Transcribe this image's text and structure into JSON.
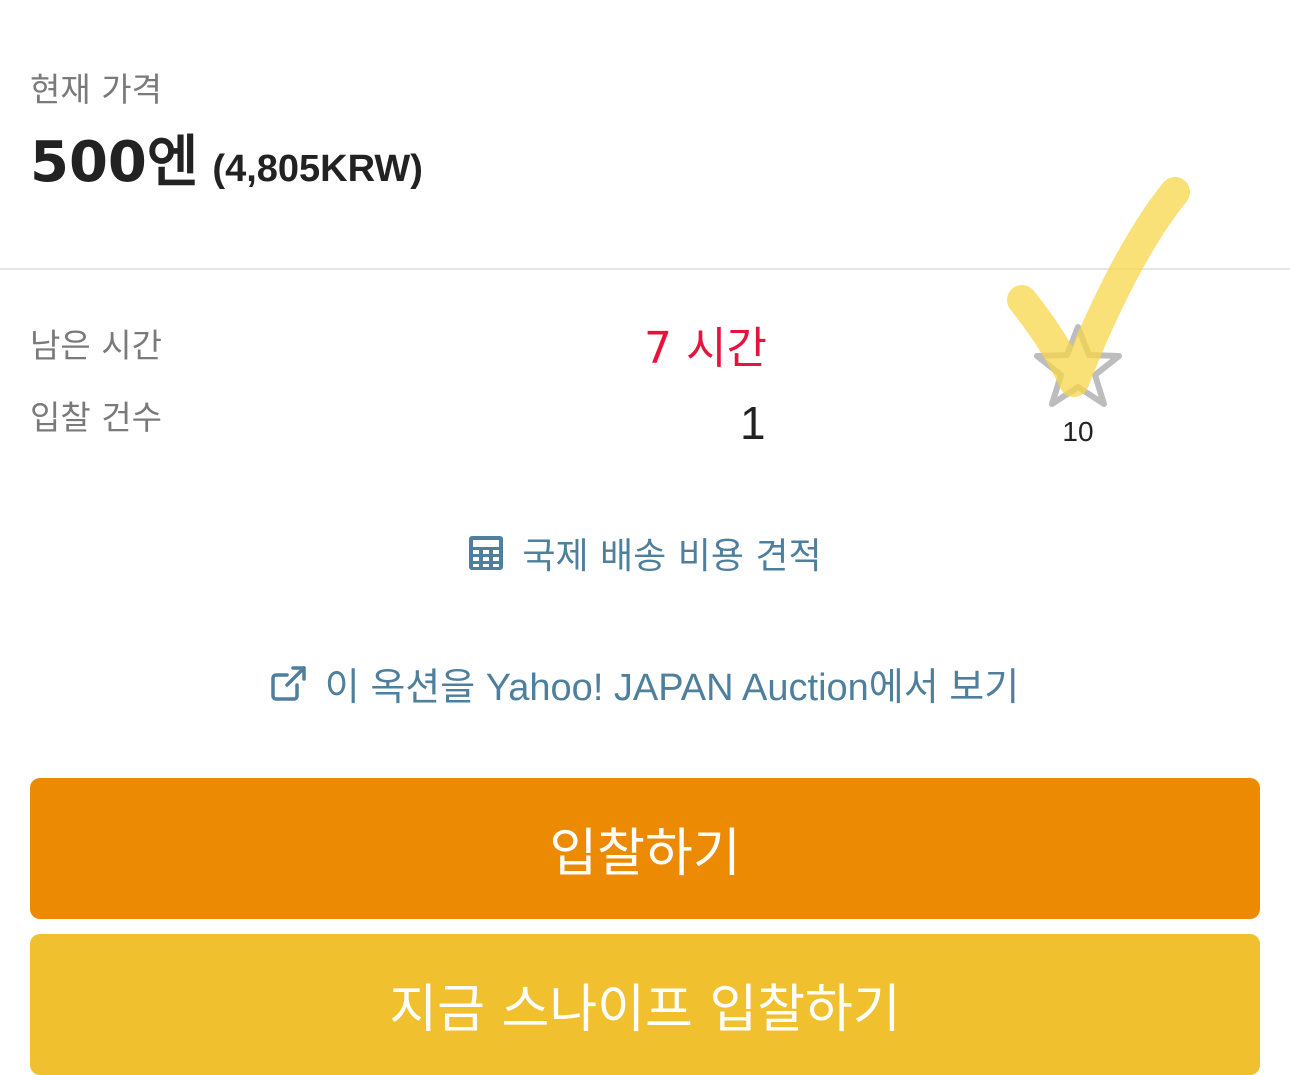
{
  "price": {
    "label": "현재 가격",
    "amount": "500엔",
    "converted": "(4,805KRW)"
  },
  "auction_info": {
    "time_left_label": "남은 시간",
    "time_left_value": "7 시간",
    "bid_count_label": "입찰 건수",
    "bid_count_value": "1"
  },
  "watchlist": {
    "count": "10",
    "icon": "star-icon",
    "overlay_icon": "check-icon"
  },
  "links": {
    "shipping_estimate": "국제 배송 비용 견적",
    "shipping_icon": "calculator-icon",
    "view_on_yahoo": "이 옥션을 Yahoo! JAPAN Auction에서 보기",
    "external_icon": "external-link-icon"
  },
  "actions": {
    "bid_label": "입찰하기",
    "snipe_label": "지금 스나이프 입찰하기"
  },
  "colors": {
    "bid_button": "#ec8a04",
    "snipe_button": "#f0c02f",
    "time_left": "#e6143c",
    "link": "#4e7f9d"
  }
}
